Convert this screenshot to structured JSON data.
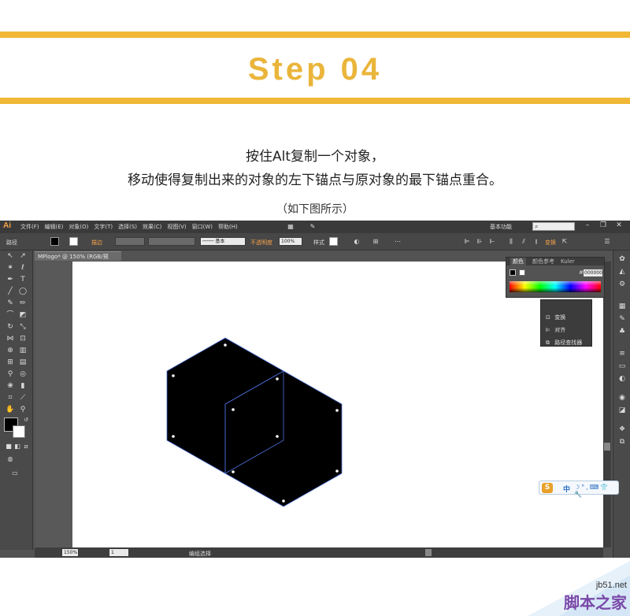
{
  "header": {
    "title": "Step 04",
    "line1": "按住Alt复制一个对象，",
    "line2": "移动使得复制出来的对象的左下锚点与原对象的最下锚点重合。",
    "note": "（如下图所示）",
    "accent_color": "#f0b836"
  },
  "app": {
    "logo": "Ai",
    "menus": [
      "文件(F)",
      "编辑(E)",
      "对象(O)",
      "文字(T)",
      "选择(S)",
      "效果(C)",
      "视图(V)",
      "窗口(W)",
      "帮助(H)"
    ],
    "workspace": "基本功能",
    "search_placeholder": "",
    "window_controls": [
      "–",
      "❐",
      "✕"
    ]
  },
  "control_bar": {
    "path_label": "路径",
    "stroke_label": "描边",
    "brush_label": "基本",
    "opacity_label": "不透明度",
    "opacity_value": "100%",
    "style_label": "样式",
    "transform_label": "变换"
  },
  "document": {
    "tab_title": "MPlogo* @ 150% (RGB/预览)",
    "tab_close": "✕"
  },
  "status_bar": {
    "zoom": "150%",
    "page": "1",
    "tool_name": "编组选择"
  },
  "color_panel": {
    "tabs": [
      "颜色",
      "颜色参考",
      "Kuler"
    ],
    "hex_value": "000000",
    "hash": "#"
  },
  "tools_panel": {
    "items": [
      {
        "icon": "transform-icon",
        "label": "变换"
      },
      {
        "icon": "align-icon",
        "label": "对齐"
      },
      {
        "icon": "pathfinder-icon",
        "label": "路径查找器"
      }
    ]
  },
  "ime": {
    "logo": "S",
    "lang": "中",
    "icons": "☽°,⌨👕🔧"
  },
  "watermark": {
    "url": "jb51.net",
    "name": "脚本之家"
  }
}
